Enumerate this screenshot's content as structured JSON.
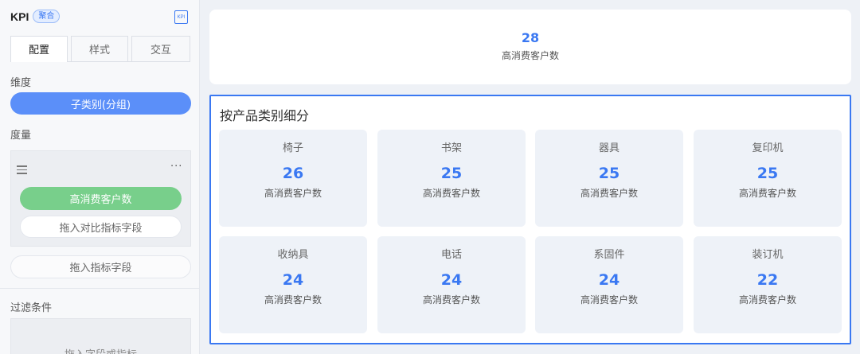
{
  "panel": {
    "title": "KPI",
    "badge": "聚合",
    "kpi_icon_text": "KPI",
    "tabs": [
      {
        "label": "配置"
      },
      {
        "label": "样式"
      },
      {
        "label": "交互"
      }
    ],
    "active_tab": "配置",
    "dimension": {
      "label": "维度",
      "field": "子类别(分组)"
    },
    "measure": {
      "label": "度量",
      "menu_icon": "drag-handle-icon",
      "more_icon": "more-icon",
      "more_text": "···",
      "field": "高消费客户数",
      "compare_placeholder": "拖入对比指标字段"
    },
    "metric_placeholder": "拖入指标字段",
    "filter": {
      "label": "过滤条件",
      "placeholder": "拖入字段或指标"
    }
  },
  "colors": {
    "accent": "#3a78f2",
    "dimension_pill": "#5b8ff9",
    "measure_pill": "#78cf8b"
  },
  "kpi": {
    "value": "28",
    "label": "高消费客户数"
  },
  "breakdown": {
    "title": "按产品类别细分",
    "items": [
      {
        "name": "椅子",
        "value": "26",
        "label": "高消费客户数"
      },
      {
        "name": "书架",
        "value": "25",
        "label": "高消费客户数"
      },
      {
        "name": "器具",
        "value": "25",
        "label": "高消费客户数"
      },
      {
        "name": "复印机",
        "value": "25",
        "label": "高消费客户数"
      },
      {
        "name": "收纳具",
        "value": "24",
        "label": "高消费客户数"
      },
      {
        "name": "电话",
        "value": "24",
        "label": "高消费客户数"
      },
      {
        "name": "系固件",
        "value": "24",
        "label": "高消费客户数"
      },
      {
        "name": "装订机",
        "value": "22",
        "label": "高消费客户数"
      }
    ]
  }
}
